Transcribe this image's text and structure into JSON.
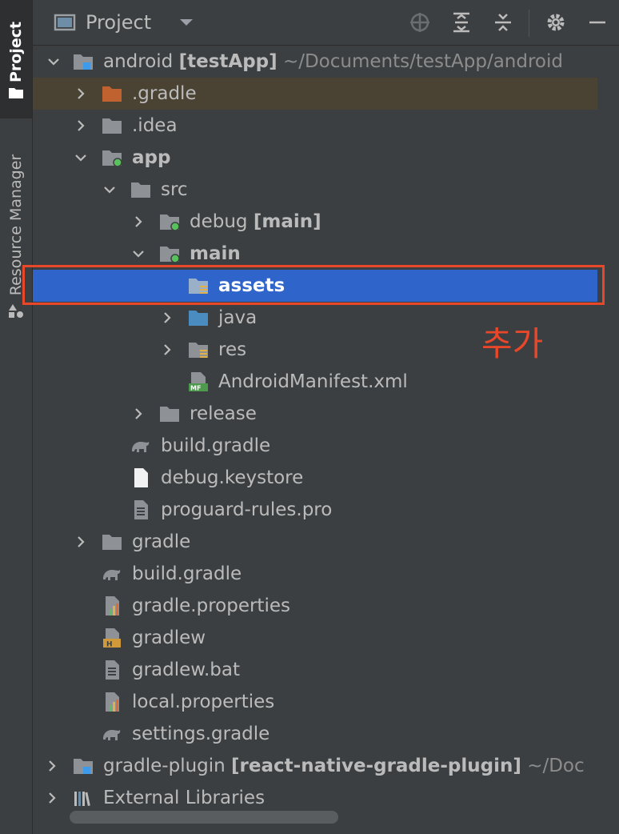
{
  "sidebar": {
    "project_tab": "Project",
    "resource_manager_tab": "Resource Manager"
  },
  "toolbar": {
    "title": "Project",
    "icons": [
      "dropdown-icon",
      "locate-icon",
      "expand-all-icon",
      "collapse-all-icon",
      "gear-icon",
      "minimize-icon"
    ]
  },
  "tree": {
    "rows": [
      {
        "name": "android",
        "bold": "[testApp]",
        "suffix": "~/Documents/testApp/android"
      },
      {
        "name": ".gradle"
      },
      {
        "name": ".idea"
      },
      {
        "name": "app"
      },
      {
        "name": "src"
      },
      {
        "name": "debug",
        "bold": "[main]"
      },
      {
        "name": "main"
      },
      {
        "name": "assets"
      },
      {
        "name": "java"
      },
      {
        "name": "res"
      },
      {
        "name": "AndroidManifest.xml"
      },
      {
        "name": "release"
      },
      {
        "name": "build.gradle"
      },
      {
        "name": "debug.keystore"
      },
      {
        "name": "proguard-rules.pro"
      },
      {
        "name": "gradle"
      },
      {
        "name": "build.gradle"
      },
      {
        "name": "gradle.properties"
      },
      {
        "name": "gradlew"
      },
      {
        "name": "gradlew.bat"
      },
      {
        "name": "local.properties"
      },
      {
        "name": "settings.gradle"
      },
      {
        "name": "gradle-plugin",
        "bold": "[react-native-gradle-plugin]",
        "suffix": "~/Doc"
      },
      {
        "name": "External Libraries"
      }
    ]
  },
  "annotation": {
    "text": "추가",
    "color": "#e8472a"
  },
  "colors": {
    "selected_row": "#2f65ca",
    "highlight_row": "#4a4334",
    "panel_bg": "#3c3f41"
  }
}
